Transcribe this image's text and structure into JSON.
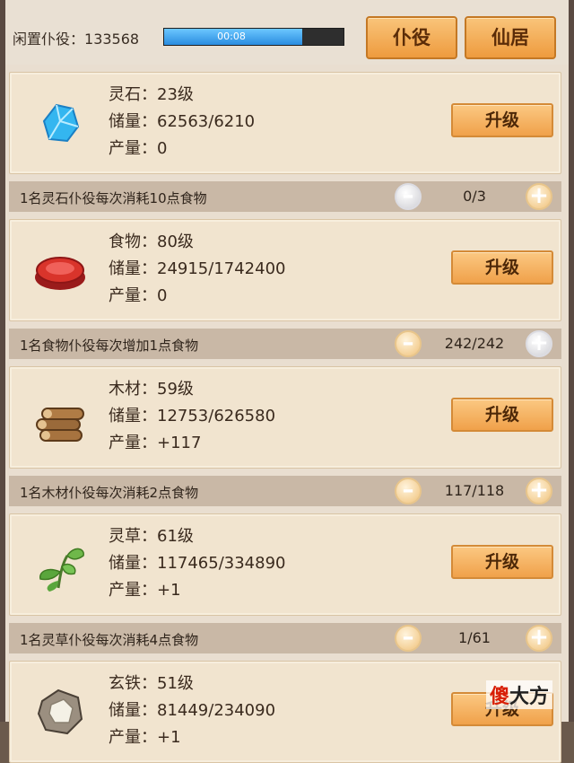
{
  "header": {
    "idle_label": "闲置仆役：",
    "idle_count": "133568",
    "timer": "00:08",
    "timer_progress_fraction": 0.77,
    "servant_button": "仆役",
    "palace_button": "仙居"
  },
  "resources": [
    {
      "name_level": "灵石：23级",
      "storage": "储量：62563/6210",
      "output": "产量：0",
      "icon": "spirit-stone-icon",
      "upgrade": "升级",
      "rule": "1名灵石仆役每次消耗10点食物",
      "count": "0/3",
      "minus_dim": true,
      "plus_dim": false
    },
    {
      "name_level": "食物：80级",
      "storage": "储量：24915/1742400",
      "output": "产量：0",
      "icon": "food-icon",
      "upgrade": "升级",
      "rule": "1名食物仆役每次增加1点食物",
      "count": "242/242",
      "minus_dim": false,
      "plus_dim": true
    },
    {
      "name_level": "木材：59级",
      "storage": "储量：12753/626580",
      "output": "产量：+117",
      "icon": "wood-icon",
      "upgrade": "升级",
      "rule": "1名木材仆役每次消耗2点食物",
      "count": "117/118",
      "minus_dim": false,
      "plus_dim": false
    },
    {
      "name_level": "灵草：61级",
      "storage": "储量：117465/334890",
      "output": "产量：+1",
      "icon": "spirit-herb-icon",
      "upgrade": "升级",
      "rule": "1名灵草仆役每次消耗4点食物",
      "count": "1/61",
      "minus_dim": false,
      "plus_dim": false
    },
    {
      "name_level": "玄铁：51级",
      "storage": "储量：81449/234090",
      "output": "产量：+1",
      "icon": "black-iron-icon",
      "upgrade": "升级"
    }
  ],
  "watermark": {
    "first": "傻",
    "rest": "大方"
  }
}
